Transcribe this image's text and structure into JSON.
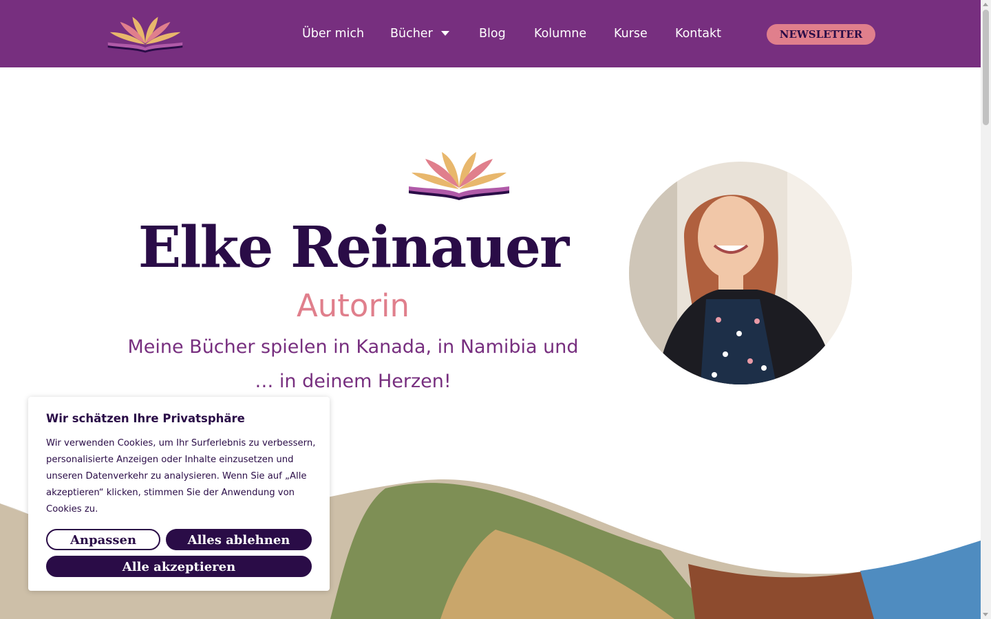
{
  "colors": {
    "brand_purple": "#772f7f",
    "dark_purple": "#2a0c47",
    "rose": "#e07f8c",
    "gold": "#e8b76c"
  },
  "header": {
    "logo_icon": "open-book-lotus-icon",
    "nav": [
      {
        "label": "Über mich"
      },
      {
        "label": "Bücher",
        "dropdown_icon": "caret-down-icon"
      },
      {
        "label": "Blog"
      },
      {
        "label": "Kolumne"
      },
      {
        "label": "Kurse"
      },
      {
        "label": "Kontakt"
      }
    ],
    "newsletter_label": "NEWSLETTER"
  },
  "hero": {
    "logo_icon": "open-book-lotus-icon",
    "name": "Elke Reinauer",
    "role": "Autorin",
    "tagline": "Meine Bücher spielen in Kanada, in Namibia und … in deinem Herzen!"
  },
  "cookie_banner": {
    "title": "Wir schätzen Ihre Privatsphäre",
    "text": "Wir verwenden Cookies, um Ihr Surferlebnis zu verbessern, personalisierte Anzeigen oder Inhalte einzusetzen und unseren Datenverkehr zu analysieren. Wenn Sie auf „Alle akzeptieren“ klicken, stimmen Sie der Anwendung von Cookies zu.",
    "customize_label": "Anpassen",
    "reject_label": "Alles ablehnen",
    "accept_label": "Alle akzeptieren"
  }
}
